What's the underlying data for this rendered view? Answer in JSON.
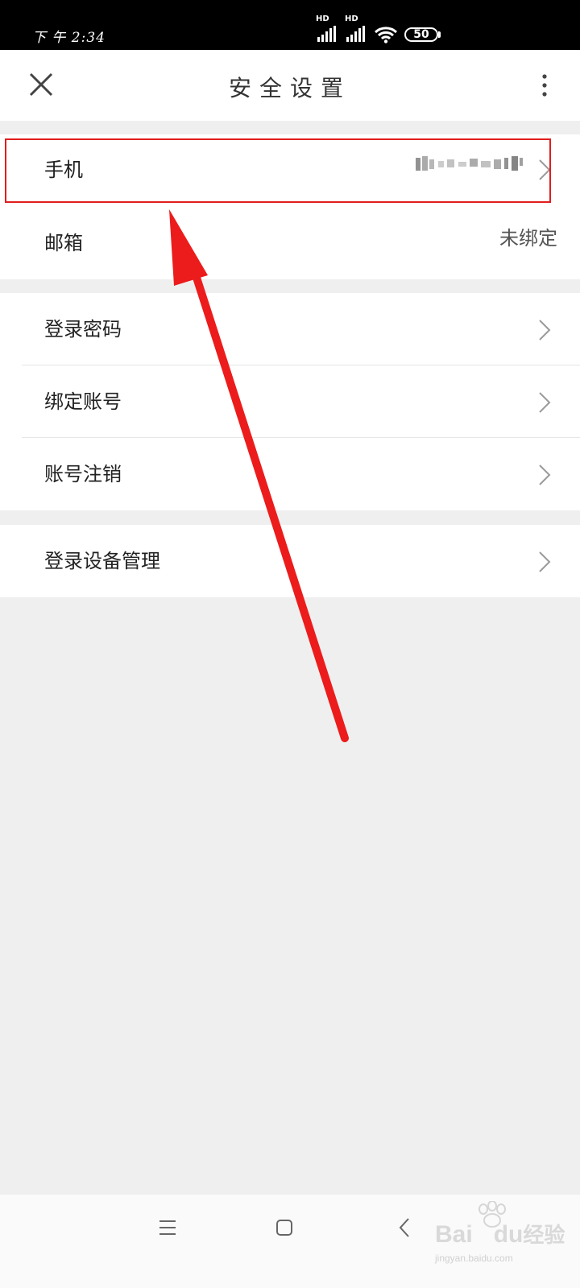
{
  "status_bar": {
    "time": "下 午 2:34",
    "network_1": "HD",
    "network_2": "HD",
    "battery": "50",
    "icons": [
      "signal-icon",
      "signal-icon",
      "wifi-icon",
      "battery-icon"
    ]
  },
  "nav": {
    "title": "安全设置",
    "close_icon": "close-icon",
    "more_icon": "more-vertical-icon"
  },
  "groups": [
    {
      "rows": [
        {
          "label": "手机",
          "value": "",
          "chevron": true,
          "highlighted": true
        },
        {
          "label": "邮箱",
          "value": "未绑定",
          "chevron": false
        }
      ]
    },
    {
      "rows": [
        {
          "label": "登录密码",
          "chevron": true
        },
        {
          "label": "绑定账号",
          "chevron": true
        },
        {
          "label": "账号注销",
          "chevron": true
        }
      ]
    },
    {
      "rows": [
        {
          "label": "登录设备管理",
          "chevron": true
        }
      ]
    }
  ],
  "system_nav": {
    "icons": [
      "menu-icon",
      "home-icon",
      "back-icon"
    ]
  },
  "watermark": {
    "brand_left": "Bai",
    "brand_right": "du",
    "brand_suffix": "经验",
    "url": "jingyan.baidu.com"
  },
  "colors": {
    "highlight": "#e21d1d",
    "background": "#efefef"
  }
}
